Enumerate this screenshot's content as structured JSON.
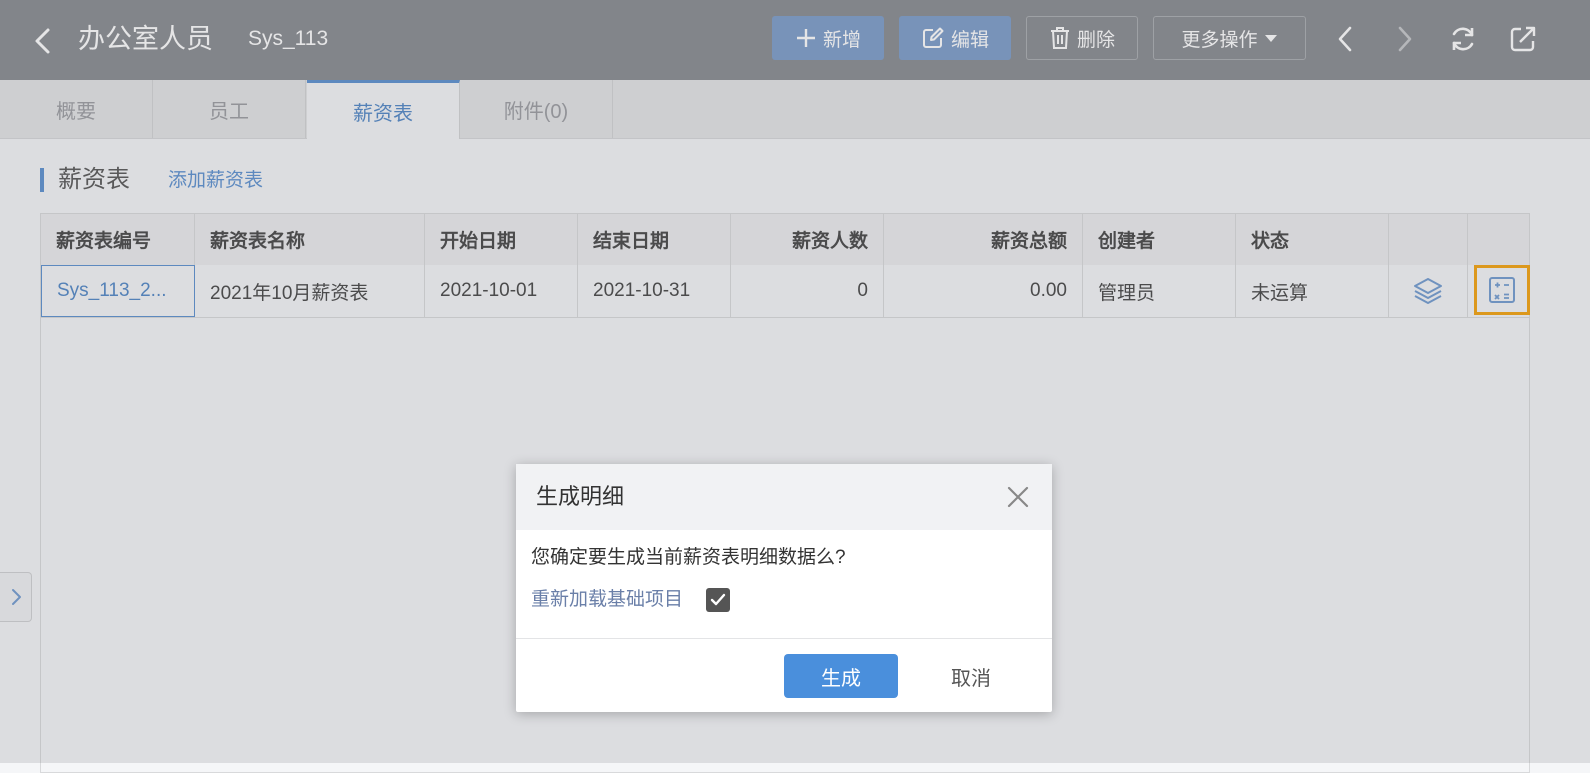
{
  "header": {
    "title": "办公室人员",
    "record_id": "Sys_113",
    "buttons": {
      "add": "新增",
      "edit": "编辑",
      "delete": "删除",
      "more": "更多操作"
    }
  },
  "tabs": [
    {
      "label": "概要"
    },
    {
      "label": "员工"
    },
    {
      "label": "薪资表"
    },
    {
      "label": "附件(0)"
    }
  ],
  "active_tab": "薪资表",
  "section": {
    "title": "薪资表",
    "add_link": "添加薪资表"
  },
  "table": {
    "columns": [
      "薪资表编号",
      "薪资表名称",
      "开始日期",
      "结束日期",
      "薪资人数",
      "薪资总额",
      "创建者",
      "状态"
    ],
    "rows": [
      {
        "id": "Sys_113_2...",
        "name": "2021年10月薪资表",
        "start_date": "2021-10-01",
        "end_date": "2021-10-31",
        "headcount": "0",
        "total": "0.00",
        "creator": "管理员",
        "status": "未运算"
      }
    ]
  },
  "dialog": {
    "title": "生成明细",
    "message": "您确定要生成当前薪资表明细数据么?",
    "option_label": "重新加载基础项目",
    "option_checked": true,
    "confirm": "生成",
    "cancel": "取消"
  },
  "colors": {
    "header_bg": "#878a8f",
    "accent": "#4a8fdc",
    "highlight": "#f5a20a"
  }
}
